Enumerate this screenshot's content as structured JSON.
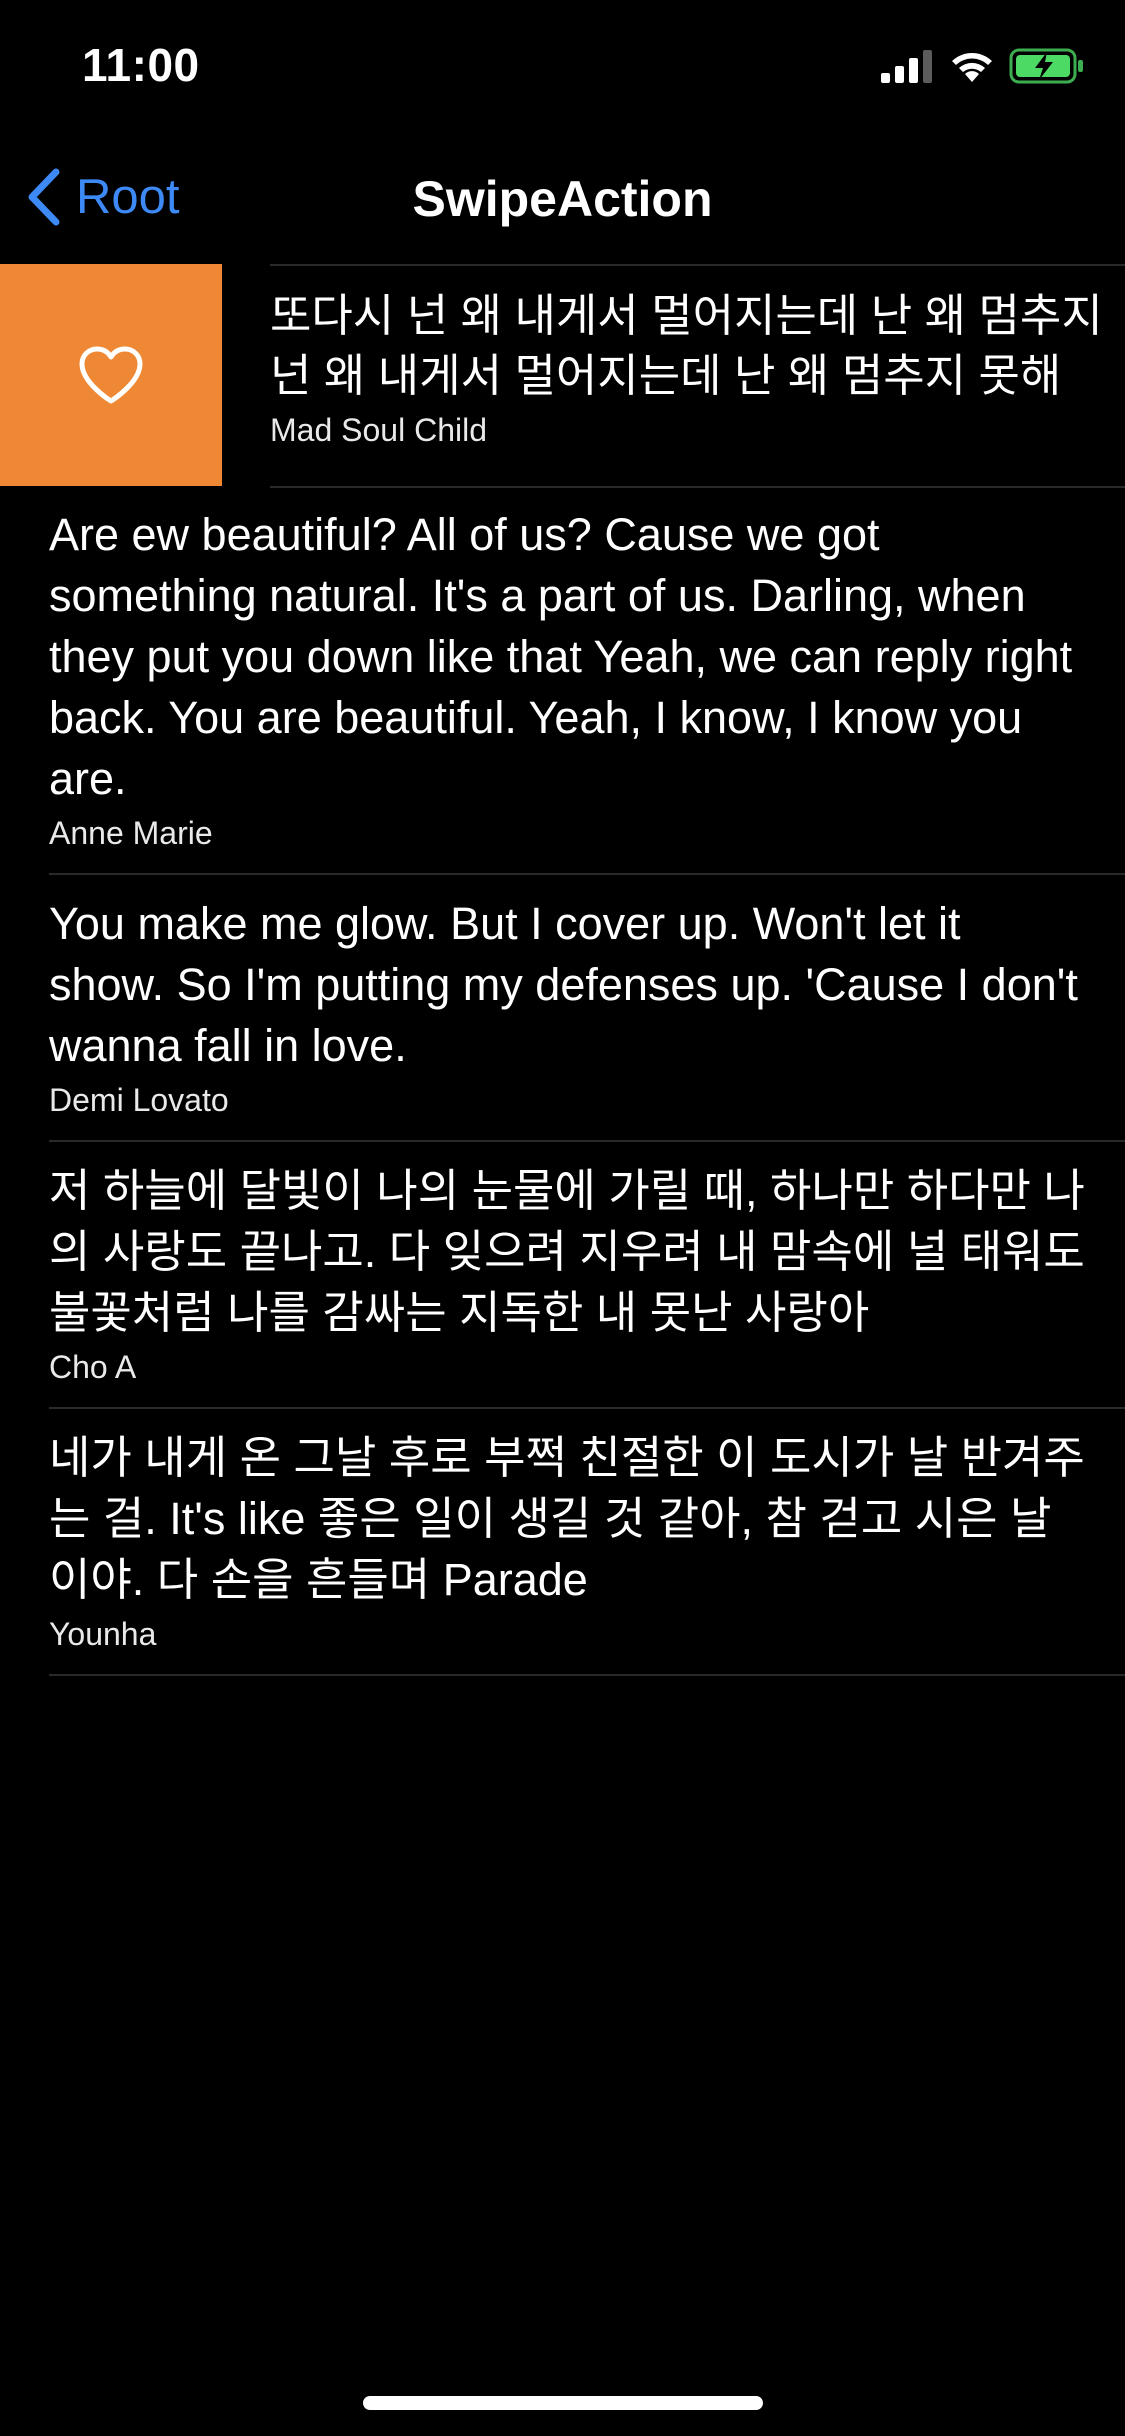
{
  "status_bar": {
    "time": "11:00"
  },
  "nav": {
    "back_label": "Root",
    "title": "SwipeAction"
  },
  "colors": {
    "accent_blue": "#3d8af7",
    "swipe_orange": "#ee8834",
    "battery_green": "#4cd964"
  },
  "swiped_row": {
    "action_icon": "heart-icon",
    "lyric_line1": "또다시 넌 왜 내게서 멀어지는데 난 왜 멈추지",
    "lyric_line2": "넌 왜 내게서 멀어지는데 난 왜 멈추지 못해",
    "artist": "Mad Soul Child"
  },
  "rows": [
    {
      "lyric": "Are ew beautiful? All of us? Cause we got something natural. It's a part of us. Darling, when they put you down like that Yeah, we can reply right back. You are beautiful. Yeah, I know, I know you are.",
      "artist": "Anne Marie"
    },
    {
      "lyric": "You make me glow. But I cover up. Won't let it show. So I'm putting my defenses up. 'Cause I don't wanna fall in love.",
      "artist": "Demi Lovato"
    },
    {
      "lyric": "저 하늘에 달빛이 나의 눈물에 가릴 때, 하나만 하다만 나의 사랑도 끝나고. 다 잊으려 지우려 내 맘속에 널 태워도 불꽃처럼 나를 감싸는 지독한 내 못난 사랑아",
      "artist": "Cho A"
    },
    {
      "lyric": "네가 내게 온 그날 후로 부쩍 친절한 이 도시가 날 반겨주는 걸. It's like 좋은 일이 생길 것 같아, 참 걷고 시은 날이야. 다 손을 흔들며 Parade",
      "artist": "Younha"
    }
  ]
}
